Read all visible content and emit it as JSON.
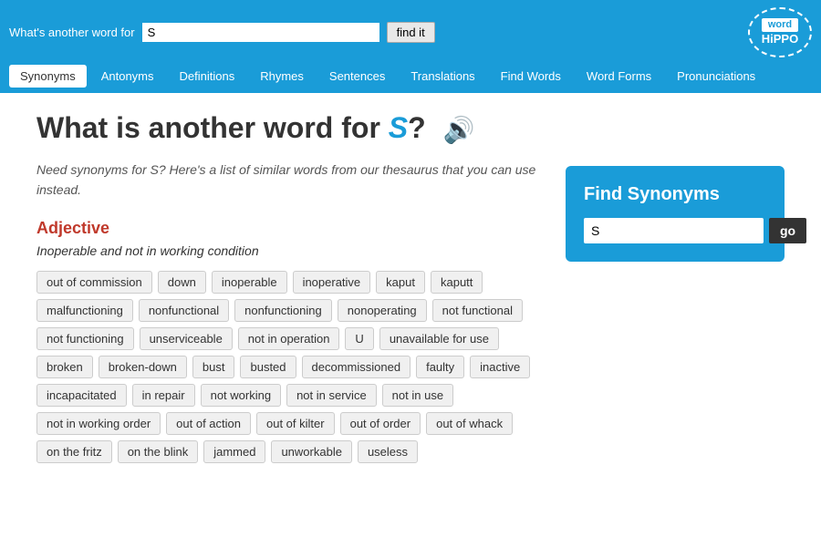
{
  "topbar": {
    "label": "What's another word for",
    "input_value": "S",
    "button_label": "find it"
  },
  "logo": {
    "line1": "word",
    "line2": "HiPPO"
  },
  "nav": {
    "tabs": [
      {
        "label": "Synonyms",
        "active": true
      },
      {
        "label": "Antonyms",
        "active": false
      },
      {
        "label": "Definitions",
        "active": false
      },
      {
        "label": "Rhymes",
        "active": false
      },
      {
        "label": "Sentences",
        "active": false
      },
      {
        "label": "Translations",
        "active": false
      },
      {
        "label": "Find Words",
        "active": false
      },
      {
        "label": "Word Forms",
        "active": false
      },
      {
        "label": "Pronunciations",
        "active": false
      }
    ]
  },
  "main": {
    "title_prefix": "What is another word for ",
    "title_word": "S",
    "title_suffix": "?",
    "description": "Need synonyms for S? Here's a list of similar words from our thesaurus that you can use instead.",
    "sections": [
      {
        "pos": "Adjective",
        "subheading": "Inoperable and not in working condition",
        "words": [
          "out of commission",
          "down",
          "inoperable",
          "inoperative",
          "kaput",
          "kaputt",
          "malfunctioning",
          "nonfunctional",
          "nonfunctioning",
          "nonoperating",
          "not functional",
          "not functioning",
          "unserviceable",
          "not in operation",
          "U",
          "unavailable for use",
          "broken",
          "broken-down",
          "bust",
          "busted",
          "decommissioned",
          "faulty",
          "inactive",
          "incapacitated",
          "in repair",
          "not working",
          "not in service",
          "not in use",
          "not in working order",
          "out of action",
          "out of kilter",
          "out of order",
          "out of whack",
          "on the fritz",
          "on the blink",
          "jammed",
          "unworkable",
          "useless"
        ]
      }
    ]
  },
  "sidebar": {
    "find_synonyms_heading": "Find Synonyms",
    "input_value": "S",
    "button_label": "go"
  }
}
